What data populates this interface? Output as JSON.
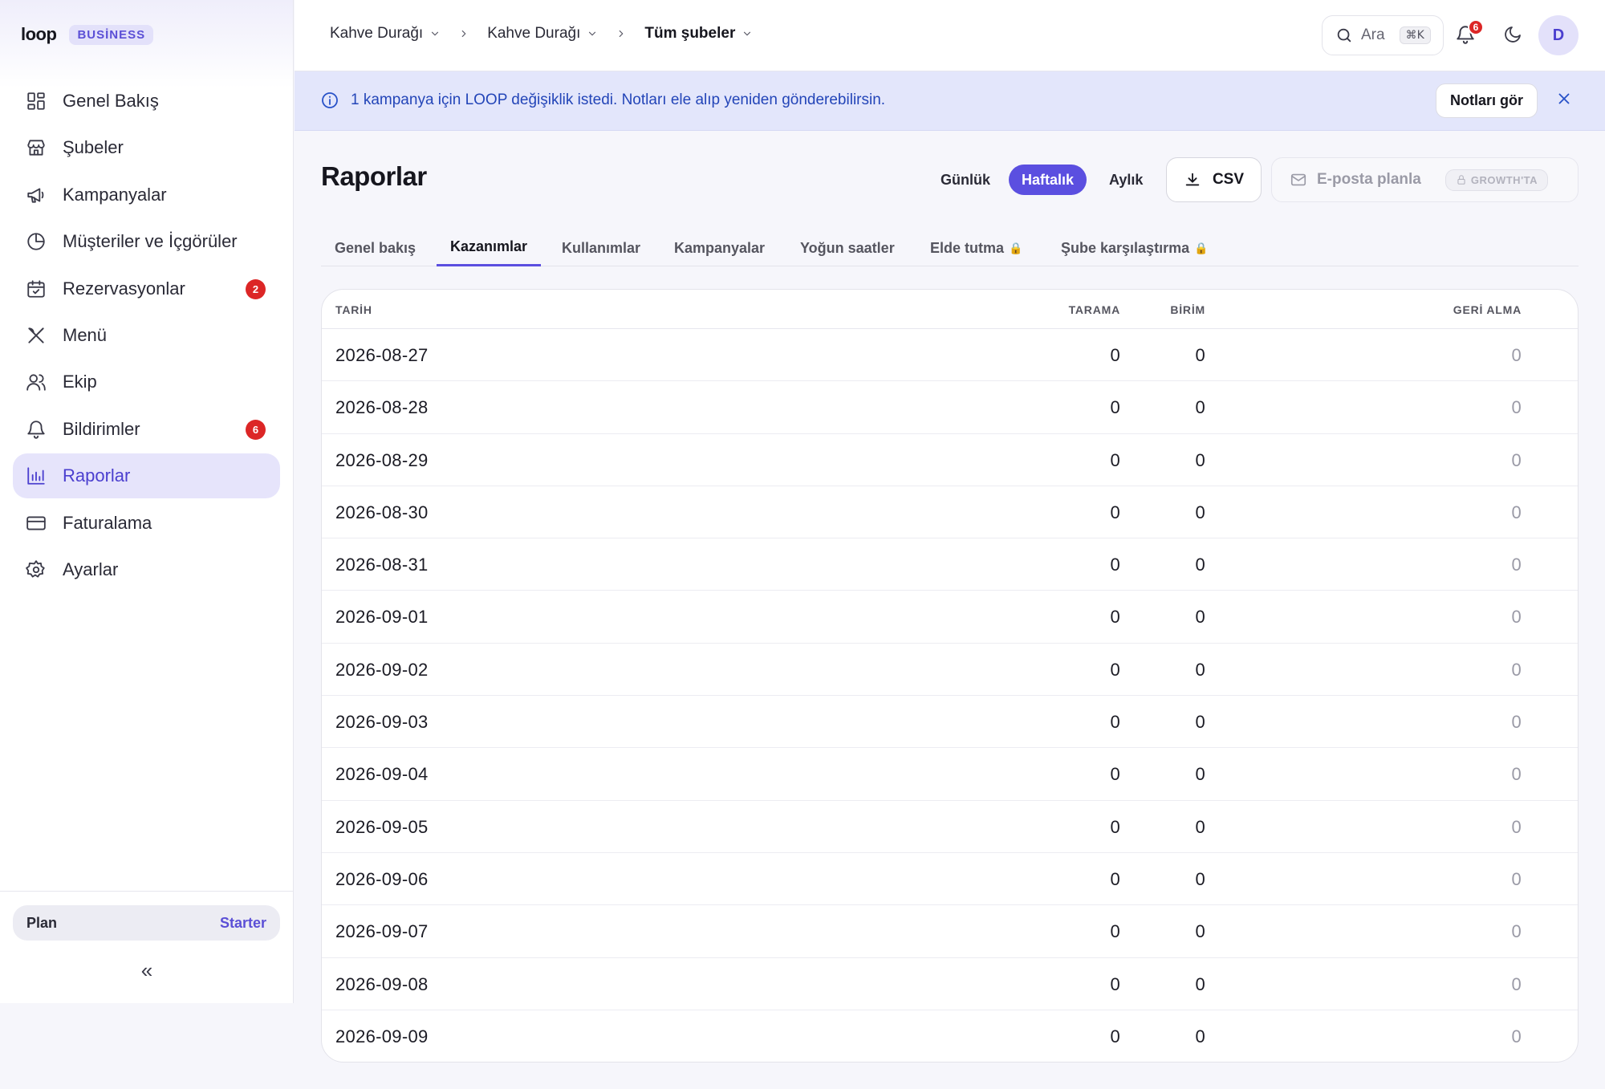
{
  "sidebar": {
    "logo": "loop",
    "badge": "BUSİNESS",
    "items": [
      {
        "label": "Genel Bakış",
        "icon": "dashboard-icon"
      },
      {
        "label": "Şubeler",
        "icon": "store-icon"
      },
      {
        "label": "Kampanyalar",
        "icon": "megaphone-icon"
      },
      {
        "label": "Müşteriler ve İçgörüler",
        "icon": "pie-chart-icon"
      },
      {
        "label": "Rezervasyonlar",
        "icon": "calendar-icon",
        "badge": "2"
      },
      {
        "label": "Menü",
        "icon": "utensils-icon"
      },
      {
        "label": "Ekip",
        "icon": "users-icon"
      },
      {
        "label": "Bildirimler",
        "icon": "bell-icon",
        "badge": "6"
      },
      {
        "label": "Raporlar",
        "icon": "bar-chart-icon",
        "active": true
      },
      {
        "label": "Faturalama",
        "icon": "credit-card-icon"
      },
      {
        "label": "Ayarlar",
        "icon": "gear-icon"
      }
    ],
    "plan_label": "Plan",
    "plan_value": "Starter",
    "collapse": "«"
  },
  "topbar": {
    "breadcrumbs": [
      "Kahve Durağı",
      "Kahve Durağı",
      "Tüm şubeler"
    ],
    "search_label": "Ara",
    "search_shortcut": "⌘K",
    "notification_count": "6",
    "avatar_initial": "D"
  },
  "banner": {
    "text": "1 kampanya için LOOP değişiklik istedi. Notları ele alıp yeniden gönderebilirsin.",
    "button": "Notları gör"
  },
  "page": {
    "title": "Raporlar",
    "periods": [
      "Günlük",
      "Haftalık",
      "Aylık"
    ],
    "active_period": "Haftalık",
    "csv_label": "CSV",
    "email_label": "E-posta planla",
    "growth_badge": "GROWTH'TA"
  },
  "tabs": [
    {
      "label": "Genel bakış"
    },
    {
      "label": "Kazanımlar",
      "active": true
    },
    {
      "label": "Kullanımlar"
    },
    {
      "label": "Kampanyalar"
    },
    {
      "label": "Yoğun saatler"
    },
    {
      "label": "Elde tutma",
      "locked": true
    },
    {
      "label": "Şube karşılaştırma",
      "locked": true
    }
  ],
  "table": {
    "columns": [
      "TARİH",
      "TARAMA",
      "BİRİM",
      "GERİ ALMA"
    ],
    "rows": [
      {
        "date": "2026-08-27",
        "scan": "0",
        "unit": "0",
        "redeem": "0"
      },
      {
        "date": "2026-08-28",
        "scan": "0",
        "unit": "0",
        "redeem": "0"
      },
      {
        "date": "2026-08-29",
        "scan": "0",
        "unit": "0",
        "redeem": "0"
      },
      {
        "date": "2026-08-30",
        "scan": "0",
        "unit": "0",
        "redeem": "0"
      },
      {
        "date": "2026-08-31",
        "scan": "0",
        "unit": "0",
        "redeem": "0"
      },
      {
        "date": "2026-09-01",
        "scan": "0",
        "unit": "0",
        "redeem": "0"
      },
      {
        "date": "2026-09-02",
        "scan": "0",
        "unit": "0",
        "redeem": "0"
      },
      {
        "date": "2026-09-03",
        "scan": "0",
        "unit": "0",
        "redeem": "0"
      },
      {
        "date": "2026-09-04",
        "scan": "0",
        "unit": "0",
        "redeem": "0"
      },
      {
        "date": "2026-09-05",
        "scan": "0",
        "unit": "0",
        "redeem": "0"
      },
      {
        "date": "2026-09-06",
        "scan": "0",
        "unit": "0",
        "redeem": "0"
      },
      {
        "date": "2026-09-07",
        "scan": "0",
        "unit": "0",
        "redeem": "0"
      },
      {
        "date": "2026-09-08",
        "scan": "0",
        "unit": "0",
        "redeem": "0"
      },
      {
        "date": "2026-09-09",
        "scan": "0",
        "unit": "0",
        "redeem": "0"
      }
    ]
  },
  "colors": {
    "accent": "#5b4fe0",
    "banner_bg": "#e3e6fb",
    "badge_red": "#dc2626"
  }
}
